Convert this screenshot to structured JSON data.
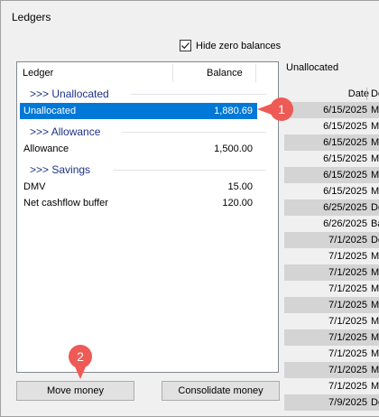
{
  "window": {
    "title": "Ledgers"
  },
  "options": {
    "hide_zero_label": "Hide zero balances",
    "hide_zero_checked": true
  },
  "ledger_list": {
    "columns": {
      "ledger": "Ledger",
      "balance": "Balance"
    },
    "groups": [
      {
        "label": ">>> Unallocated",
        "rows": [
          {
            "name": "Unallocated",
            "balance": "1,880.69",
            "selected": true
          }
        ]
      },
      {
        "label": ">>> Allowance",
        "rows": [
          {
            "name": "Allowance",
            "balance": "1,500.00",
            "selected": false
          }
        ]
      },
      {
        "label": ">>> Savings",
        "rows": [
          {
            "name": "DMV",
            "balance": "15.00",
            "selected": false
          },
          {
            "name": "Net cashflow buffer",
            "balance": "120.00",
            "selected": false
          }
        ]
      }
    ]
  },
  "buttons": {
    "move_money": "Move money",
    "consolidate_money": "Consolidate money"
  },
  "callouts": {
    "first": "1",
    "second": "2"
  },
  "transactions": {
    "ledger_name": "Unallocated",
    "columns": {
      "date": "Date",
      "description": "De"
    },
    "rows": [
      {
        "date": "6/15/2025",
        "desc": "Mo"
      },
      {
        "date": "6/15/2025",
        "desc": "Mo"
      },
      {
        "date": "6/15/2025",
        "desc": "Mo"
      },
      {
        "date": "6/15/2025",
        "desc": "Mo"
      },
      {
        "date": "6/15/2025",
        "desc": "Mo"
      },
      {
        "date": "6/15/2025",
        "desc": "Mo"
      },
      {
        "date": "6/25/2025",
        "desc": "De"
      },
      {
        "date": "6/26/2025",
        "desc": "Ba"
      },
      {
        "date": "7/1/2025",
        "desc": "De"
      },
      {
        "date": "7/1/2025",
        "desc": "Mo"
      },
      {
        "date": "7/1/2025",
        "desc": "Mo"
      },
      {
        "date": "7/1/2025",
        "desc": "Mo"
      },
      {
        "date": "7/1/2025",
        "desc": "Mo"
      },
      {
        "date": "7/1/2025",
        "desc": "Mo"
      },
      {
        "date": "7/1/2025",
        "desc": "Mo"
      },
      {
        "date": "7/1/2025",
        "desc": "Mo"
      },
      {
        "date": "7/1/2025",
        "desc": "Mo"
      },
      {
        "date": "7/1/2025",
        "desc": "Mo"
      },
      {
        "date": "7/9/2025",
        "desc": "De"
      }
    ]
  },
  "colors": {
    "selection": "#0078d7",
    "group_text": "#1e3287",
    "callout": "#ee5a55",
    "alt_row": "#d4d4d4"
  }
}
